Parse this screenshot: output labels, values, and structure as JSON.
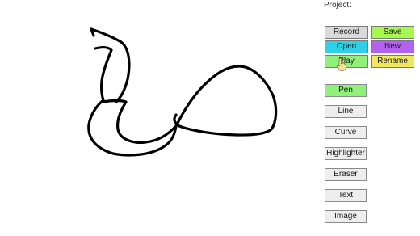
{
  "panel": {
    "project_label": "Project:",
    "actions": {
      "record": "Record",
      "save": "Save",
      "open": "Open",
      "new": "New",
      "play": "Play",
      "rename": "Rename"
    },
    "tools": {
      "pen": "Pen",
      "line": "Line",
      "curve": "Curve",
      "highlighter": "Highlighter",
      "eraser": "Eraser",
      "text": "Text",
      "image": "Image"
    },
    "selected_tool": "Pen"
  },
  "colors": {
    "record": "#d9d9d9",
    "save": "#a6f94c",
    "open": "#2fd0e6",
    "new": "#b561ef",
    "play": "#8ff07a",
    "rename": "#f2e85e",
    "pen_selected": "#8ff07a",
    "stroke": "#000000"
  }
}
